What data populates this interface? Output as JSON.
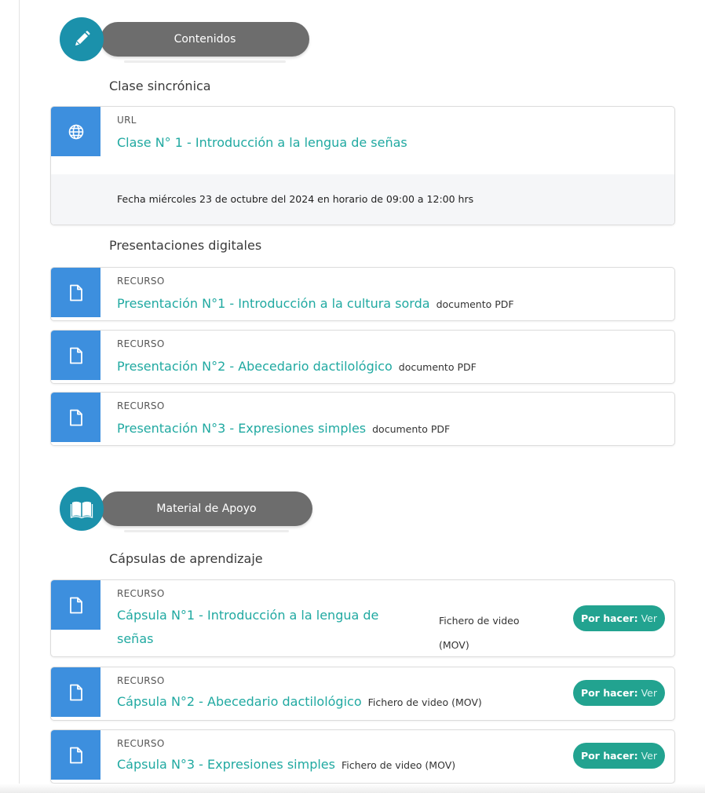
{
  "sections": {
    "contenidos": {
      "label": "Contenidos"
    },
    "material": {
      "label": "Material de Apoyo"
    }
  },
  "clase": {
    "heading": "Clase sincrónica",
    "type": "URL",
    "title": "Clase N° 1 - Introducción a la lengua de señas",
    "footer": "Fecha miércoles 23 de octubre del 2024 en horario de 09:00 a 12:00 hrs"
  },
  "presentaciones": {
    "heading": "Presentaciones digitales",
    "items": [
      {
        "type": "RECURSO",
        "title": "Presentación N°1 - Introducción a la cultura sorda",
        "file": "documento PDF"
      },
      {
        "type": "RECURSO",
        "title": "Presentación N°2 - Abecedario dactilológico",
        "file": "documento PDF"
      },
      {
        "type": "RECURSO",
        "title": "Presentación N°3 - Expresiones simples",
        "file": "documento PDF"
      }
    ]
  },
  "capsulas": {
    "heading": "Cápsulas de aprendizaje",
    "items": [
      {
        "type": "RECURSO",
        "title_line1": "Cápsula N°1 - Introducción a la lengua de",
        "title_line2": "señas",
        "file_line1": "Fichero de video",
        "file_line2": "(MOV)",
        "badge_status": "Por hacer:",
        "badge_action": "Ver"
      },
      {
        "type": "RECURSO",
        "title": "Cápsula N°2 - Abecedario dactilológico",
        "file": "Fichero de video (MOV)",
        "badge_status": "Por hacer:",
        "badge_action": "Ver"
      },
      {
        "type": "RECURSO",
        "title": "Cápsula N°3 - Expresiones simples",
        "file": "Fichero de video (MOV)",
        "badge_status": "Por hacer:",
        "badge_action": "Ver"
      }
    ]
  },
  "colors": {
    "accent_teal": "#20a9a1",
    "icon_blue": "#3d8fde",
    "header_circle": "#1b91ab",
    "badge_green": "#22a390",
    "pill_gray": "#6d6d6d"
  },
  "icons": {
    "contenidos": "pencil-icon",
    "material": "book-icon",
    "url": "globe-icon",
    "recurso": "document-icon"
  }
}
